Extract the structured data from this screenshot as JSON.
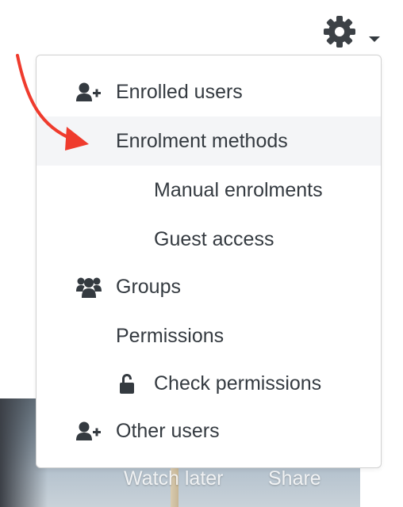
{
  "menu": {
    "items": [
      {
        "label": "Enrolled users",
        "icon": "add-user-icon"
      },
      {
        "label": "Enrolment methods",
        "icon": ""
      },
      {
        "label": "Manual enrolments",
        "icon": ""
      },
      {
        "label": "Guest access",
        "icon": ""
      },
      {
        "label": "Groups",
        "icon": "users-group-icon"
      },
      {
        "label": "Permissions",
        "icon": ""
      },
      {
        "label": "Check permissions",
        "icon": "unlock-icon"
      },
      {
        "label": "Other users",
        "icon": "add-user-icon"
      }
    ]
  },
  "video": {
    "watch_later": "Watch later",
    "share": "Share"
  },
  "colors": {
    "text": "#343a40",
    "active_row": "#f4f5f7",
    "annotation_arrow": "#ef3b2d"
  }
}
